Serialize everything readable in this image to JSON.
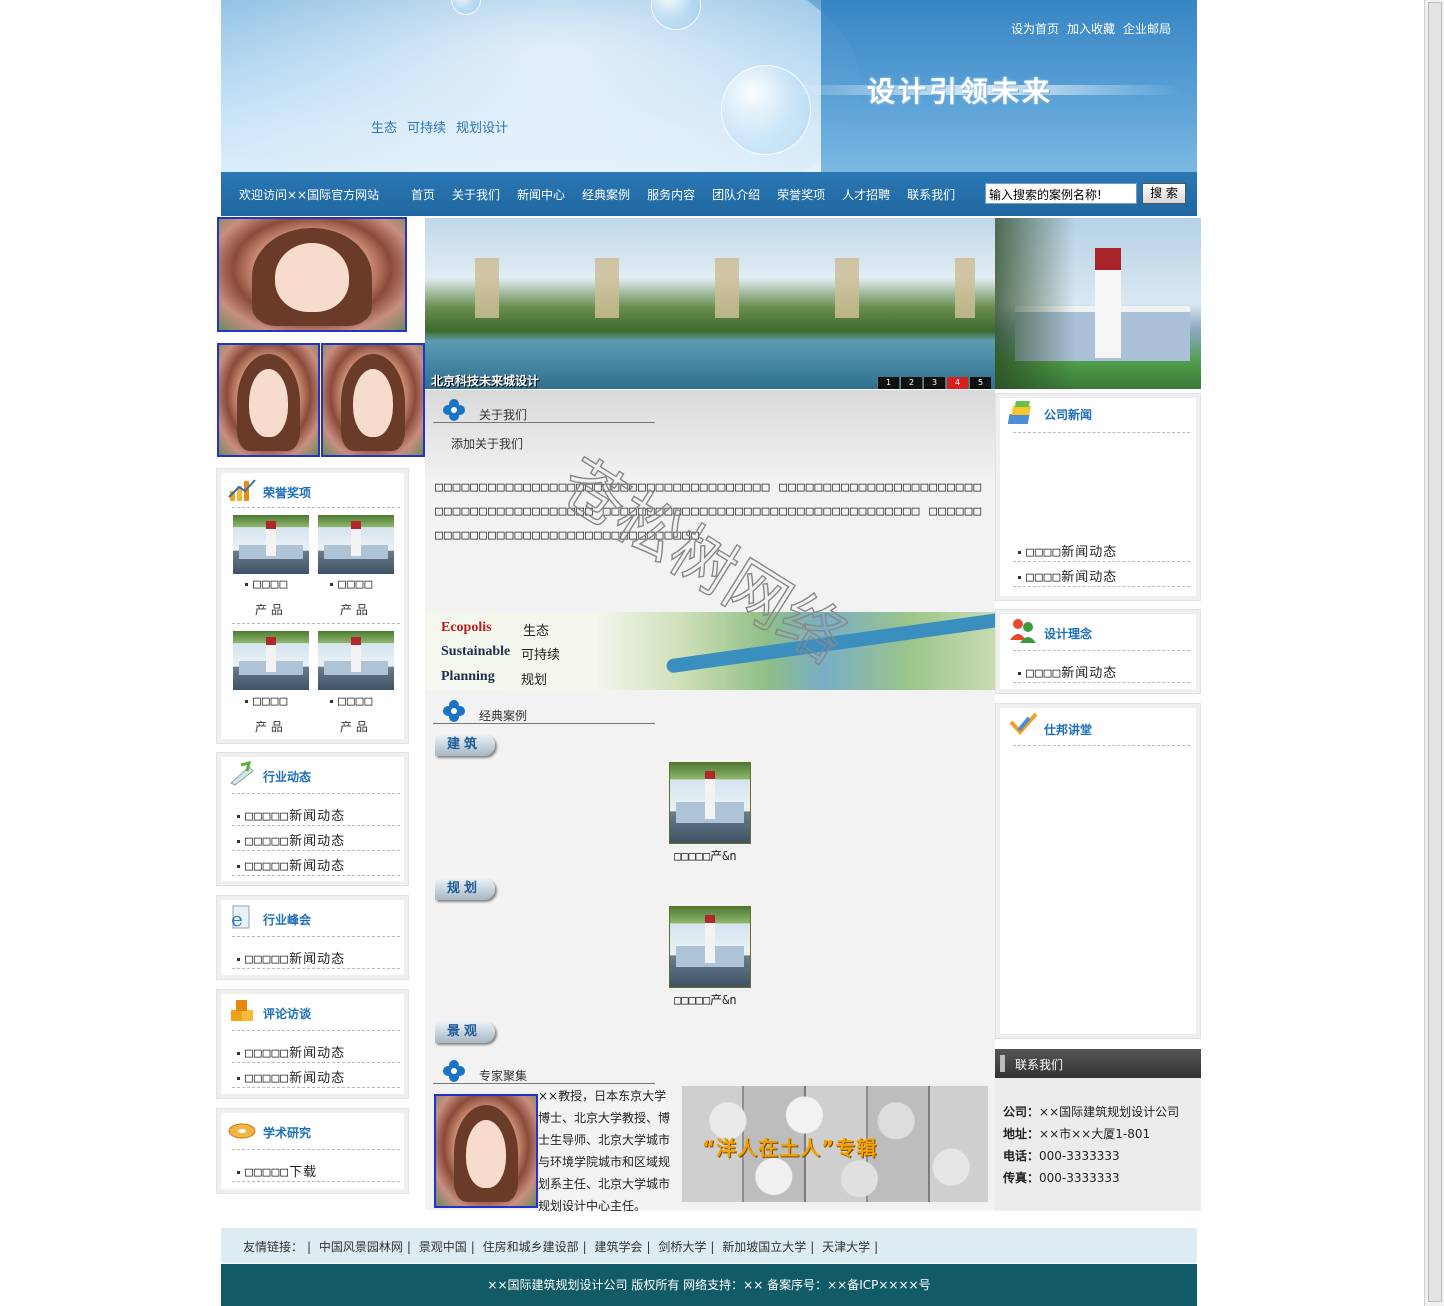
{
  "header": {
    "top_links": [
      "设为首页",
      "加入收藏",
      "企业邮局"
    ],
    "slogan": "设计引领未来",
    "tags": [
      "生态",
      "可持续",
      "规划设计"
    ]
  },
  "nav": {
    "welcome": "欢迎访问××国际官方网站",
    "items": [
      "首页",
      "关于我们",
      "新闻中心",
      "经典案例",
      "服务内容",
      "团队介绍",
      "荣誉奖项",
      "人才招聘",
      "联系我们"
    ],
    "search_value": "输入搜索的案例名称!",
    "search_button": "搜 索"
  },
  "banner": {
    "caption": "北京科技未来城设计",
    "pages": [
      "1",
      "2",
      "3",
      "4",
      "5"
    ],
    "active_page": "4"
  },
  "left": {
    "honors": {
      "title": "荣誉奖项",
      "products": [
        {
          "name": "□□□□",
          "sub": "产 品"
        },
        {
          "name": "□□□□",
          "sub": "产 品"
        },
        {
          "name": "□□□□",
          "sub": "产 品"
        },
        {
          "name": "□□□□",
          "sub": "产 品"
        }
      ]
    },
    "industry_news": {
      "title": "行业动态",
      "items": [
        "□□□□□新闻动态",
        "□□□□□新闻动态",
        "□□□□□新闻动态"
      ]
    },
    "summit": {
      "title": "行业峰会",
      "items": [
        "□□□□□新闻动态"
      ]
    },
    "reviews": {
      "title": "评论访谈",
      "items": [
        "□□□□□新闻动态",
        "□□□□□新闻动态"
      ]
    },
    "research": {
      "title": "学术研究",
      "items": [
        "□□□□□下载"
      ]
    }
  },
  "middle": {
    "about": {
      "title": "关于我们",
      "subtitle": "添加关于我们",
      "body": "□□□□□□□□□□□□□□□□□□□□□□□□□□□□□□□□□□□□□□ □□□□□□□□□□□□□□□□□□□□□□□□□□□□□□□□□□□□□□□□□ □□□□□□□□□□□□□□□□□□□□□□□□□□□□□□□□□□□□ □□□□□□□□□□□□□□□□□□□□□□□□□□□□□□□□□□□□"
    },
    "strip": {
      "en": [
        "Ecopolis",
        "Sustainable",
        "Planning"
      ],
      "cn": [
        "生态",
        "可持续",
        "规划"
      ]
    },
    "cases": {
      "title": "经典案例",
      "categories": [
        {
          "label": "建筑",
          "caption": "□□□□□产&n"
        },
        {
          "label": "规划",
          "caption": "□□□□□产&n"
        },
        {
          "label": "景观",
          "caption": ""
        }
      ]
    },
    "experts": {
      "title": "专家聚集",
      "bio": "××教授，日本东京大学博士、北京大学教授、博士生导师、北京大学城市与环境学院城市和区域规划系主任、北京大学城市规划设计中心主任。",
      "collage_title": "“洋人在土人”专辑"
    }
  },
  "right": {
    "company_news": {
      "title": "公司新闻",
      "items": [
        "□□□□新闻动态",
        "□□□□新闻动态"
      ]
    },
    "design_concept": {
      "title": "设计理念",
      "items": [
        "□□□□新闻动态"
      ]
    },
    "lecture": {
      "title": "仕邦讲堂"
    },
    "contact": {
      "title": "联系我们",
      "rows": [
        {
          "label": "公司：",
          "value": "××国际建筑规划设计公司"
        },
        {
          "label": "地址：",
          "value": "××市××大厦1-801"
        },
        {
          "label": "电话：",
          "value": "000-3333333"
        },
        {
          "label": "传真：",
          "value": "000-3333333"
        }
      ]
    }
  },
  "footer": {
    "links_label": "友情链接：",
    "links": [
      "中国风景园林网",
      "景观中国",
      "住房和城乡建设部",
      "建筑学会",
      "剑桥大学",
      "新加坡国立大学",
      "天津大学"
    ],
    "copyright": "××国际建筑规划设计公司 版权所有 网络支持：×× 备案序号：××备ICP××××号"
  },
  "watermark": "苍松树网络"
}
